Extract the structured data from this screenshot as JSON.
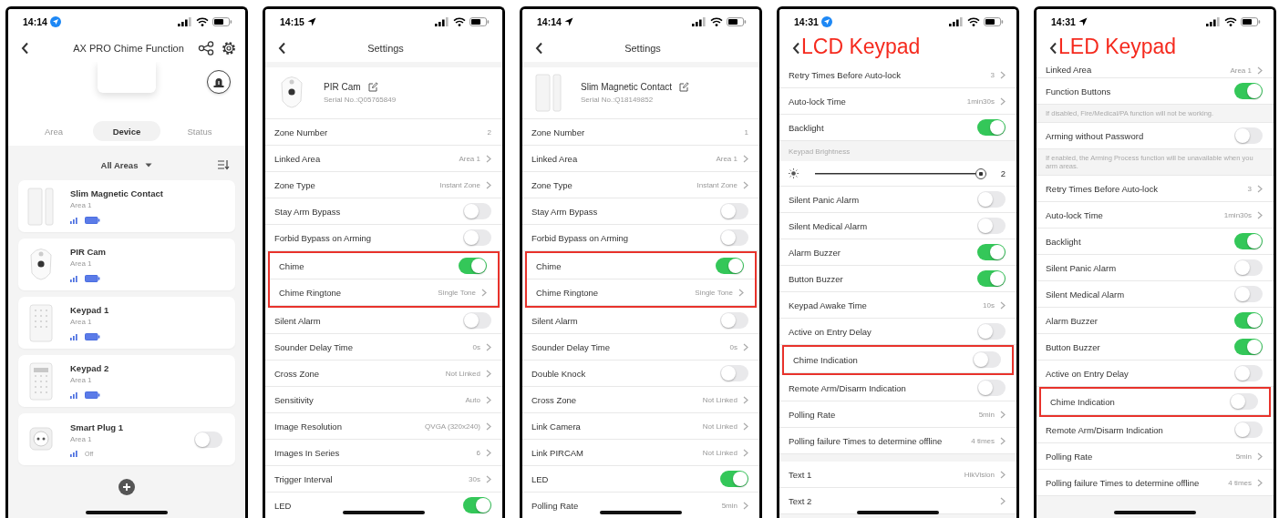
{
  "phones": [
    {
      "kind": "device_list",
      "time": "14:14",
      "location_badge": true,
      "title": "AX PRO Chime Function",
      "tabs": [
        {
          "label": "Area",
          "selected": false
        },
        {
          "label": "Device",
          "selected": true
        },
        {
          "label": "Status",
          "selected": false
        }
      ],
      "filter": "All Areas",
      "devices": [
        {
          "kind": "contact",
          "name": "Slim Magnetic Contact",
          "area": "Area 1"
        },
        {
          "kind": "pir",
          "name": "PIR Cam",
          "area": "Area 1"
        },
        {
          "kind": "keypad",
          "name": "Keypad 1",
          "area": "Area 1"
        },
        {
          "kind": "lcd_keypad",
          "name": "Keypad 2",
          "area": "Area 1"
        },
        {
          "kind": "plug",
          "name": "Smart Plug 1",
          "area": "Area 1",
          "status": "Off",
          "on": false
        }
      ]
    },
    {
      "kind": "settings",
      "time": "14:15",
      "location_badge": false,
      "title": "Settings",
      "device": {
        "kind": "pir",
        "name": "PIR Cam",
        "serial": "Serial No.:Q05765849"
      },
      "rows": [
        {
          "kind": "value",
          "label": "Zone Number",
          "value": "2",
          "chevron": false,
          "highlighted": false
        },
        {
          "kind": "value",
          "label": "Linked Area",
          "value": "Area 1",
          "chevron": true,
          "highlighted": false
        },
        {
          "kind": "value",
          "label": "Zone Type",
          "value": "Instant Zone",
          "chevron": true,
          "highlighted": false
        },
        {
          "kind": "toggle",
          "label": "Stay Arm Bypass",
          "on": false,
          "highlighted": false
        },
        {
          "kind": "toggle",
          "label": "Forbid Bypass on Arming",
          "on": false,
          "highlighted": false
        },
        {
          "kind": "toggle",
          "label": "Chime",
          "on": true,
          "highlighted": true
        },
        {
          "kind": "value",
          "label": "Chime Ringtone",
          "value": "Single Tone",
          "chevron": true,
          "highlighted": true
        },
        {
          "kind": "toggle",
          "label": "Silent Alarm",
          "on": false,
          "highlighted": false
        },
        {
          "kind": "value",
          "label": "Sounder Delay Time",
          "value": "0s",
          "chevron": true,
          "highlighted": false
        },
        {
          "kind": "value",
          "label": "Cross Zone",
          "value": "Not Linked",
          "chevron": true,
          "highlighted": false
        },
        {
          "kind": "value",
          "label": "Sensitivity",
          "value": "Auto",
          "chevron": true,
          "highlighted": false
        },
        {
          "kind": "value",
          "label": "Image Resolution",
          "value": "QVGA (320x240)",
          "chevron": true,
          "highlighted": false
        },
        {
          "kind": "value",
          "label": "Images In Series",
          "value": "6",
          "chevron": true,
          "highlighted": false
        },
        {
          "kind": "value",
          "label": "Trigger Interval",
          "value": "30s",
          "chevron": true,
          "highlighted": false
        },
        {
          "kind": "toggle",
          "label": "LED",
          "on": true,
          "highlighted": false
        }
      ]
    },
    {
      "kind": "settings",
      "time": "14:14",
      "location_badge": false,
      "title": "Settings",
      "device": {
        "kind": "contact",
        "name": "Slim Magnetic Contact",
        "serial": "Serial No.:Q18149852"
      },
      "rows": [
        {
          "kind": "value",
          "label": "Zone Number",
          "value": "1",
          "chevron": false,
          "highlighted": false
        },
        {
          "kind": "value",
          "label": "Linked Area",
          "value": "Area 1",
          "chevron": true,
          "highlighted": false
        },
        {
          "kind": "value",
          "label": "Zone Type",
          "value": "Instant Zone",
          "chevron": true,
          "highlighted": false
        },
        {
          "kind": "toggle",
          "label": "Stay Arm Bypass",
          "on": false,
          "highlighted": false
        },
        {
          "kind": "toggle",
          "label": "Forbid Bypass on Arming",
          "on": false,
          "highlighted": false
        },
        {
          "kind": "toggle",
          "label": "Chime",
          "on": true,
          "highlighted": true
        },
        {
          "kind": "value",
          "label": "Chime Ringtone",
          "value": "Single Tone",
          "chevron": true,
          "highlighted": true
        },
        {
          "kind": "toggle",
          "label": "Silent Alarm",
          "on": false,
          "highlighted": false
        },
        {
          "kind": "value",
          "label": "Sounder Delay Time",
          "value": "0s",
          "chevron": true,
          "highlighted": false
        },
        {
          "kind": "toggle",
          "label": "Double Knock",
          "on": false,
          "highlighted": false
        },
        {
          "kind": "value",
          "label": "Cross Zone",
          "value": "Not Linked",
          "chevron": true,
          "highlighted": false
        },
        {
          "kind": "value",
          "label": "Link Camera",
          "value": "Not Linked",
          "chevron": true,
          "highlighted": false
        },
        {
          "kind": "value",
          "label": "Link PIRCAM",
          "value": "Not Linked",
          "chevron": true,
          "highlighted": false
        },
        {
          "kind": "toggle",
          "label": "LED",
          "on": true,
          "highlighted": false
        },
        {
          "kind": "value",
          "label": "Polling Rate",
          "value": "5min",
          "chevron": true,
          "highlighted": false
        }
      ]
    },
    {
      "kind": "settings",
      "time": "14:31",
      "location_badge": true,
      "annotation": "LCD Keypad",
      "rows": [
        {
          "kind": "value",
          "label": "Retry Times Before Auto-lock",
          "value": "3",
          "chevron": true,
          "highlighted": false
        },
        {
          "kind": "value",
          "label": "Auto-lock Time",
          "value": "1min30s",
          "chevron": true,
          "highlighted": false
        },
        {
          "kind": "toggle",
          "label": "Backlight",
          "on": true,
          "highlighted": false
        },
        {
          "kind": "section",
          "label": "Keypad Brightness"
        },
        {
          "kind": "slider",
          "level": 1,
          "reading": "2"
        },
        {
          "kind": "toggle",
          "label": "Silent Panic Alarm",
          "on": false,
          "highlighted": false
        },
        {
          "kind": "toggle",
          "label": "Silent Medical Alarm",
          "on": false,
          "highlighted": false
        },
        {
          "kind": "toggle",
          "label": "Alarm Buzzer",
          "on": true,
          "highlighted": false
        },
        {
          "kind": "toggle",
          "label": "Button Buzzer",
          "on": true,
          "highlighted": false
        },
        {
          "kind": "value",
          "label": "Keypad Awake Time",
          "value": "10s",
          "chevron": true,
          "highlighted": false
        },
        {
          "kind": "toggle",
          "label": "Active on Entry Delay",
          "on": false,
          "highlighted": false
        },
        {
          "kind": "toggle",
          "label": "Chime Indication",
          "on": false,
          "highlighted": true
        },
        {
          "kind": "toggle",
          "label": "Remote Arm/Disarm Indication",
          "on": false,
          "highlighted": false
        },
        {
          "kind": "value",
          "label": "Polling Rate",
          "value": "5min",
          "chevron": true,
          "highlighted": false
        },
        {
          "kind": "value",
          "label": "Polling failure Times to determine offline",
          "value": "4 times",
          "chevron": true,
          "highlighted": false
        },
        {
          "kind": "spacer"
        },
        {
          "kind": "value",
          "label": "Text 1",
          "value": "HikVision",
          "chevron": true,
          "highlighted": false
        },
        {
          "kind": "value",
          "label": "Text 2",
          "chevron": true,
          "highlighted": false
        }
      ]
    },
    {
      "kind": "settings",
      "time": "14:31",
      "location_badge": false,
      "annotation": "LED Keypad",
      "rows": [
        {
          "kind": "cut",
          "label": "Linked Area",
          "value": "Area 1",
          "chevron": true,
          "highlighted": false
        },
        {
          "kind": "toggle",
          "label": "Function Buttons",
          "on": true,
          "highlighted": false
        },
        {
          "kind": "note",
          "label": "If disabled, Fire/Medical/PA function will not be working."
        },
        {
          "kind": "toggle",
          "label": "Arming without Password",
          "on": false,
          "highlighted": false
        },
        {
          "kind": "note",
          "label": "If enabled, the Arming Process function will be unavailable when you arm areas."
        },
        {
          "kind": "value",
          "label": "Retry Times Before Auto-lock",
          "value": "3",
          "chevron": true,
          "highlighted": false
        },
        {
          "kind": "value",
          "label": "Auto-lock Time",
          "value": "1min30s",
          "chevron": true,
          "highlighted": false
        },
        {
          "kind": "toggle",
          "label": "Backlight",
          "on": true,
          "highlighted": false
        },
        {
          "kind": "toggle",
          "label": "Silent Panic Alarm",
          "on": false,
          "highlighted": false
        },
        {
          "kind": "toggle",
          "label": "Silent Medical Alarm",
          "on": false,
          "highlighted": false
        },
        {
          "kind": "toggle",
          "label": "Alarm Buzzer",
          "on": true,
          "highlighted": false
        },
        {
          "kind": "toggle",
          "label": "Button Buzzer",
          "on": true,
          "highlighted": false
        },
        {
          "kind": "toggle",
          "label": "Active on Entry Delay",
          "on": false,
          "highlighted": false
        },
        {
          "kind": "toggle",
          "label": "Chime Indication",
          "on": false,
          "highlighted": true
        },
        {
          "kind": "toggle",
          "label": "Remote Arm/Disarm Indication",
          "on": false,
          "highlighted": false
        },
        {
          "kind": "value",
          "label": "Polling Rate",
          "value": "5min",
          "chevron": true,
          "highlighted": false
        },
        {
          "kind": "value",
          "label": "Polling failure Times to determine offline",
          "value": "4 times",
          "chevron": true,
          "highlighted": false
        }
      ]
    }
  ]
}
